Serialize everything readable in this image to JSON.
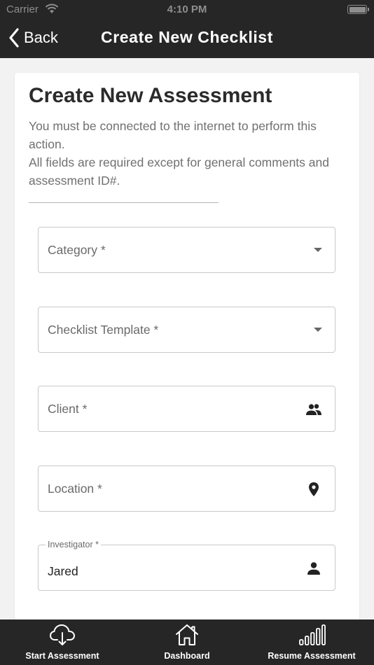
{
  "status_bar": {
    "carrier": "Carrier",
    "time": "4:10 PM"
  },
  "nav": {
    "back_label": "Back",
    "title": "Create New Checklist"
  },
  "form": {
    "title": "Create New Assessment",
    "desc_line1": "You must be connected to the internet to perform this action.",
    "desc_line2": "All fields are required except for general comments and assessment ID#.",
    "fields": [
      {
        "label": "Category *",
        "icon": "dropdown-caret"
      },
      {
        "label": "Checklist Template *",
        "icon": "dropdown-caret"
      },
      {
        "label": "Client *",
        "icon": "people-icon"
      },
      {
        "label": "Location *",
        "icon": "location-pin-icon"
      },
      {
        "label": "Investigator *",
        "value": "Jared",
        "icon": "person-icon"
      }
    ]
  },
  "tabs": [
    {
      "label": "Start Assessment",
      "icon": "cloud-download-icon"
    },
    {
      "label": "Dashboard",
      "icon": "home-icon"
    },
    {
      "label": "Resume Assessment",
      "icon": "signal-bars-icon"
    }
  ],
  "colors": {
    "bar_bg": "#262626",
    "page_bg": "#f2f2f2",
    "card_bg": "#ffffff"
  }
}
